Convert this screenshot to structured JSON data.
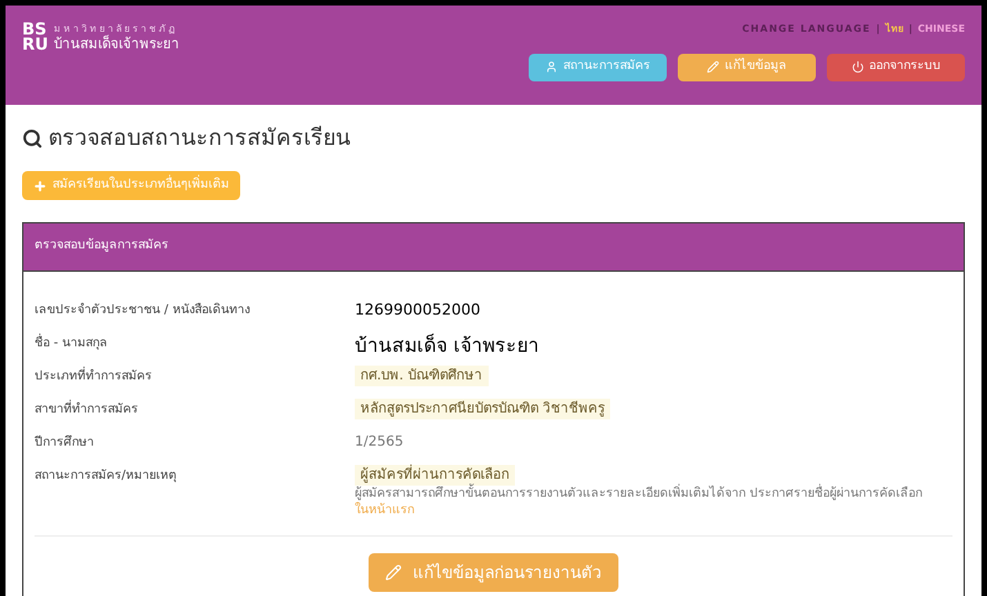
{
  "header": {
    "logo_mark": [
      "BS",
      "RU"
    ],
    "university_small": "มหาวิทยาลัยราชภัฏ",
    "university_name": "บ้านสมเด็จเจ้าพระยา",
    "language": {
      "label": "CHANGE LANGUAGE",
      "separator": "|",
      "options": [
        {
          "label": "ไทย",
          "selected": true
        },
        {
          "label": "CHINESE",
          "selected": false
        }
      ]
    },
    "buttons": [
      {
        "kind": "status",
        "label": "สถานะการสมัคร"
      },
      {
        "kind": "edit",
        "label": "แก้ไขข้อมูล"
      },
      {
        "kind": "logout",
        "label": "ออกจากระบบ"
      }
    ]
  },
  "page_title": "ตรวจสอบสถานะการสมัครเรียน",
  "add_button": "สมัครเรียนในประเภทอื่นๆเพิ่มเติม",
  "panel": {
    "title": "ตรวจสอบข้อมูลการสมัคร",
    "rows": [
      {
        "label": "เลขประจำตัวประชาชน / หนังสือเดินทาง",
        "value": "1269900052000",
        "kind": "plain"
      },
      {
        "label": "ชื่อ - นามสกุล",
        "value": "บ้านสมเด็จ  เจ้าพระยา",
        "kind": "large"
      },
      {
        "label": "ประเภทที่ทำการสมัคร",
        "value": "กศ.บพ. บัณฑิตศึกษา",
        "kind": "highlight"
      },
      {
        "label": "สาขาที่ทำการสมัคร",
        "value": "หลักสูตรประกาศนียบัตรบัณฑิต วิชาชีพครู",
        "kind": "highlight"
      },
      {
        "label": "ปีการศึกษา",
        "value": "1/2565",
        "kind": "muted"
      },
      {
        "label": "สถานะการสมัคร/หมายเหตุ",
        "value": "ผู้สมัครที่ผ่านการคัดเลือก",
        "kind": "highlight",
        "note": "ผู้สมัครสามารถศึกษาขั้นตอนการรายงานตัวและรายละเอียดเพิ่มเติมได้จาก ประกาศรายชื่อผู้ผ่านการคัดเลือก",
        "note_link": "ในหน้าแรก"
      }
    ],
    "submit_button": "แก้ไขข้อมูลก่อนรายงานตัว"
  }
}
